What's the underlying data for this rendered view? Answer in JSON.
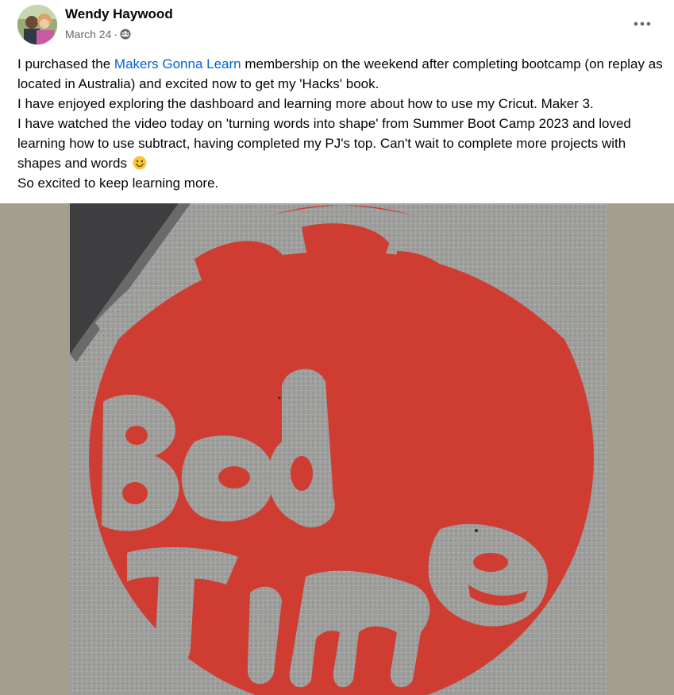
{
  "post": {
    "author": "Wendy Haywood",
    "date": "March 24",
    "separator": "·",
    "audience_icon": "group-icon",
    "more_icon": "more-options-icon",
    "text": {
      "line1_before": "I purchased the ",
      "link": "Makers Gonna Learn",
      "line1_after": " membership on the weekend after completing bootcamp (on replay as located in Australia) and excited now to get my 'Hacks' book.",
      "line2": "I have enjoyed exploring the dashboard and learning more about how to use my Cricut. Maker 3.",
      "line3": "I have watched the video today on 'turning words into shape' from Summer Boot Camp 2023 and loved learning how to use subtract, having completed my PJ's top. Can't wait to complete more projects with shapes and words",
      "emoji": "smiling-face-emoji",
      "line4": "So excited to keep learning more."
    },
    "photo": {
      "description_icon": "photo-image",
      "shirt_text": [
        "Bed",
        "Time"
      ],
      "colors": {
        "frame": "#a39f8c",
        "shirt": "#9c9c9a",
        "vinyl": "#cf3d32"
      }
    }
  }
}
